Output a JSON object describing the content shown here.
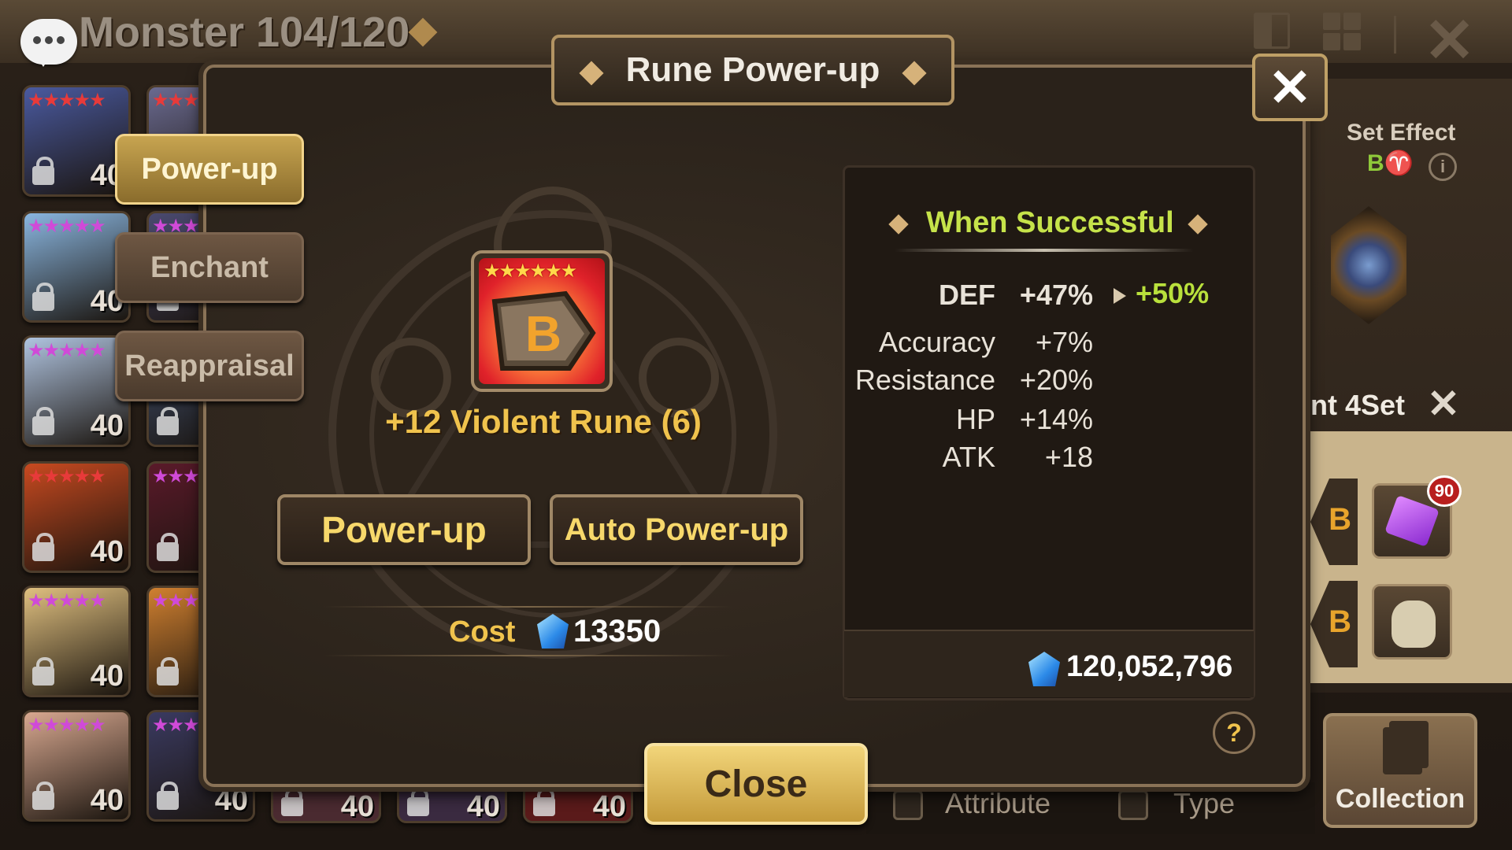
{
  "header": {
    "monster_count": "Monster 104/120"
  },
  "monsters": [
    {
      "stars": "★★★★★",
      "level": "40",
      "color": "#4a5aa0",
      "star_color": "#e83a3a"
    },
    {
      "stars": "★★★",
      "level": "",
      "color": "#6a6a90",
      "star_color": "#e83a3a"
    },
    {
      "stars": "★★★★★",
      "level": "40",
      "color": "#8ab6e0",
      "star_color": "#d04ad8"
    },
    {
      "stars": "★★★",
      "level": "",
      "color": "#4a4a70",
      "star_color": "#d04ad8"
    },
    {
      "stars": "★★★★★",
      "level": "40",
      "color": "#b0c4e0",
      "star_color": "#d04ad8"
    },
    {
      "stars": "★★★",
      "level": "",
      "color": "#405070",
      "star_color": "#d04ad8"
    },
    {
      "stars": "★★★★★",
      "level": "40",
      "color": "#c84a20",
      "star_color": "#e83a3a"
    },
    {
      "stars": "★★★",
      "level": "",
      "color": "#5a1a2a",
      "star_color": "#d04ad8"
    },
    {
      "stars": "★★★★★",
      "level": "40",
      "color": "#e0c080",
      "star_color": "#d04ad8"
    },
    {
      "stars": "★★★",
      "level": "",
      "color": "#d08030",
      "star_color": "#d04ad8"
    },
    {
      "stars": "★★★★★",
      "level": "40",
      "color": "#d8a890",
      "star_color": "#d04ad8"
    },
    {
      "stars": "★★★",
      "level": "40",
      "color": "#3a3a60",
      "star_color": "#d04ad8"
    }
  ],
  "bottom_row_levels": [
    "40",
    "40",
    "40"
  ],
  "tabs": {
    "powerup": "Power-up",
    "enchant": "Enchant",
    "reappraisal": "Reappraisal"
  },
  "dialog": {
    "title": "Rune Power-up",
    "close_symbol": "✕",
    "rune": {
      "stars": "★★★★★★",
      "glyph": "B",
      "name": "+12 Violent Rune (6)"
    },
    "buttons": {
      "powerup": "Power-up",
      "auto_powerup": "Auto Power-up"
    },
    "cost": {
      "label": "Cost",
      "value": "13350"
    }
  },
  "stats": {
    "title": "When Successful",
    "main": {
      "name": "DEF",
      "current": "+47%",
      "next": "+50%"
    },
    "subs": [
      {
        "name": "Accuracy",
        "value": "+7%"
      },
      {
        "name": "Resistance",
        "value": "+20%"
      },
      {
        "name": "HP",
        "value": "+14%"
      },
      {
        "name": "ATK",
        "value": "+18"
      }
    ],
    "balance": "120,052,796",
    "help": "?"
  },
  "close_button": "Close",
  "right_panel": {
    "set_effect": "Set Effect",
    "set_icons": "B♈",
    "info": "i",
    "set_label": "nt 4Set",
    "set_close": "✕",
    "rune_glyph": "B",
    "badge": "90",
    "collection": "Collection"
  },
  "filters": {
    "attribute": "Attribute",
    "type": "Type"
  },
  "colors": {
    "accent_gold": "#f0c34d",
    "success_green": "#c6e34a",
    "rune_red": "#e0222a"
  }
}
